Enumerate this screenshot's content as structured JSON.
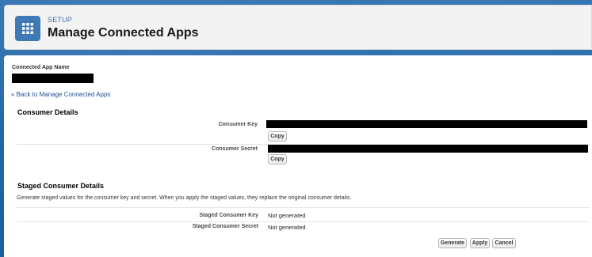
{
  "header": {
    "setup_label": "SETUP",
    "title": "Manage Connected Apps",
    "icon": "app-grid-icon"
  },
  "app": {
    "name_label": "Connected App Name",
    "back_link": "« Back to Manage Connected Apps"
  },
  "consumer_details": {
    "title": "Consumer Details",
    "key_label": "Consumer Key",
    "secret_label": "Consumer Secret",
    "copy_label": "Copy"
  },
  "staged": {
    "title": "Staged Consumer Details",
    "description": "Generate staged values for the consumer key and secret. When you apply the staged values, they replace the original consumer details.",
    "key_label": "Staged Consumer Key",
    "key_value": "Not generated",
    "secret_label": "Staged Consumer Secret",
    "secret_value": "Not generated"
  },
  "actions": {
    "generate": "Generate",
    "apply": "Apply",
    "cancel": "Cancel"
  },
  "colors": {
    "background": "#1d5e9c",
    "app_tile": "#3e7bb6",
    "link": "#1b5297"
  }
}
